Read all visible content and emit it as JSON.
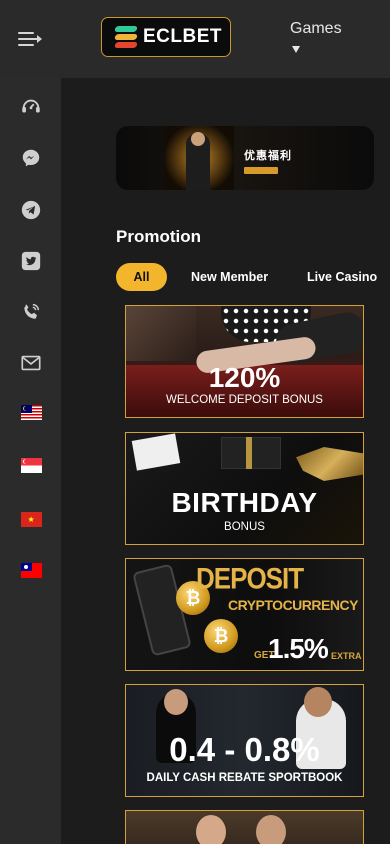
{
  "header": {
    "logo_text": "ECLBET",
    "games_label": "Games"
  },
  "sidebar": {
    "items": [
      {
        "icon": "support-agent-icon"
      },
      {
        "icon": "messenger-icon"
      },
      {
        "icon": "telegram-icon"
      },
      {
        "icon": "twitter-icon"
      },
      {
        "icon": "phone-icon"
      },
      {
        "icon": "mail-icon"
      },
      {
        "icon": "malaysia-flag-icon"
      },
      {
        "icon": "singapore-flag-icon"
      },
      {
        "icon": "vietnam-flag-icon"
      },
      {
        "icon": "taiwan-flag-icon"
      }
    ]
  },
  "top_banner": {
    "title": "优惠福利"
  },
  "promotion": {
    "title": "Promotion",
    "tabs": [
      {
        "label": "All",
        "active": true
      },
      {
        "label": "New Member",
        "active": false
      },
      {
        "label": "Live Casino",
        "active": false
      }
    ]
  },
  "cards": {
    "welcome": {
      "big": "120%",
      "small": "WELCOME DEPOSIT BONUS"
    },
    "birthday": {
      "big": "BIRTHDAY",
      "small": "BONUS"
    },
    "crypto": {
      "line1": "DEPOSIT",
      "line2": "CRYPTOCURRENCY",
      "get": "GET",
      "pct": "1.5%",
      "extra": "EXTRA"
    },
    "rebate": {
      "big": "0.4 - 0.8%",
      "small": "DAILY CASH REBATE SPORTBOOK"
    }
  },
  "colors": {
    "accent": "#f3b52b",
    "card_border": "#d3a13b",
    "background": "#1c1c1c",
    "sidebar": "#2b2b2b"
  }
}
